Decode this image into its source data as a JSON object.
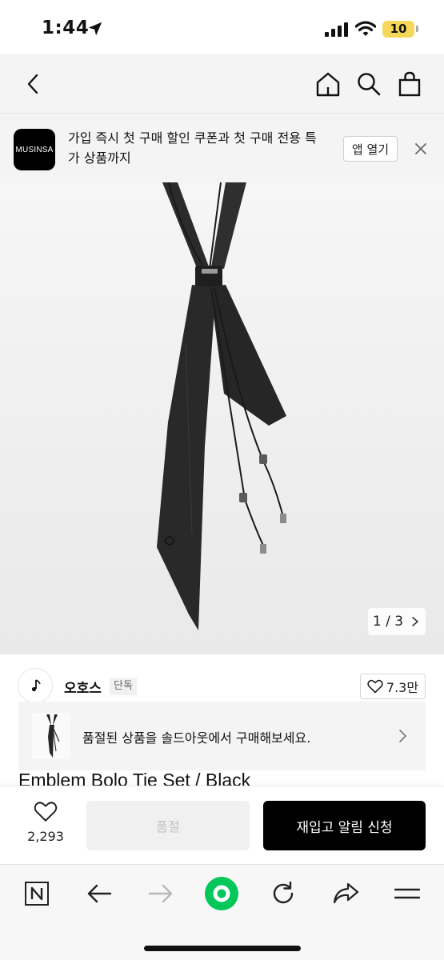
{
  "status_bar": {
    "time": "1:44",
    "battery": "10"
  },
  "header": {
    "back_icon": "chevron-left-icon",
    "home_icon": "home-icon",
    "search_icon": "search-icon",
    "bag_icon": "shopping-bag-icon"
  },
  "promo": {
    "logo_text": "MUSINSA",
    "message": "가입 즉시 첫 구매 할인 쿠폰과 첫 구매 전용 특가 상품까지",
    "open_app_label": "앱 열기"
  },
  "gallery": {
    "indicator": "1 / 3"
  },
  "brand": {
    "name": "오호스",
    "badge": "단독",
    "likes": "7.3만"
  },
  "soldout_banner": {
    "text": "품절된 상품을 솔드아웃에서 구매해보세요."
  },
  "product": {
    "title": "Emblem Bolo Tie Set / Black"
  },
  "action_bar": {
    "wish_count": "2,293",
    "soldout_label": "품절",
    "restock_label": "재입고 알림 신청"
  },
  "colors": {
    "accent_green": "#03c75a",
    "black": "#000000",
    "battery": "#f5d85a"
  }
}
